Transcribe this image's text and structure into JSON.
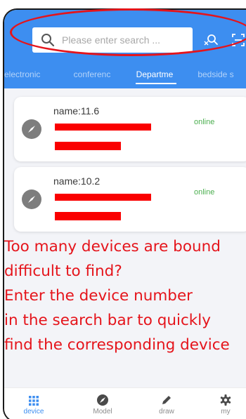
{
  "search": {
    "placeholder": "Please enter search ..."
  },
  "header": {
    "icons": [
      "search-scan-icon",
      "scan-frame-icon"
    ]
  },
  "tabs": [
    {
      "label": "electronic"
    },
    {
      "label": "conferenc"
    },
    {
      "label": "Departme"
    },
    {
      "label": "bedside s"
    }
  ],
  "active_tab": "Departme",
  "devices": [
    {
      "name": "name:11.6",
      "status": "online"
    },
    {
      "name": "name:10.2",
      "status": "online"
    }
  ],
  "promo_lines": [
    "Too many devices are bound",
    "difficult to find?",
    "Enter the device number",
    "in the search bar to quickly",
    "find the corresponding device"
  ],
  "bottom_nav": [
    {
      "label": "device",
      "icon": "grid-icon"
    },
    {
      "label": "Model",
      "icon": "compass-icon"
    },
    {
      "label": "draw",
      "icon": "pencil-icon"
    },
    {
      "label": "my",
      "icon": "gear-icon"
    }
  ],
  "colors": {
    "primary": "#3d8ef0",
    "online": "#4caf50",
    "annotation_red": "#e5141b",
    "redaction": "#fa0000"
  }
}
